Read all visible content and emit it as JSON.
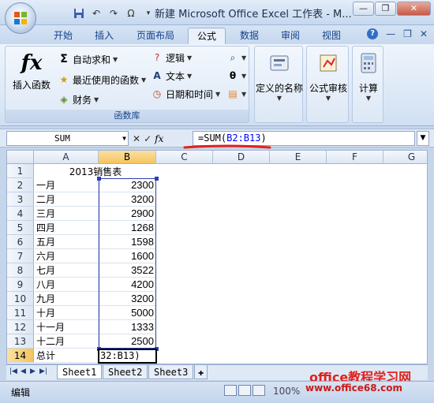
{
  "window": {
    "title": "新建 Microsoft Office Excel 工作表 - M..."
  },
  "quick_access": [
    "save-icon",
    "undo-icon",
    "redo-icon",
    "omega-icon",
    "customize-icon"
  ],
  "tabs": [
    "开始",
    "插入",
    "页面布局",
    "公式",
    "数据",
    "审阅",
    "视图"
  ],
  "active_tab": "公式",
  "ribbon": {
    "insert_function": "插入函数",
    "autosum": "自动求和",
    "recent": "最近使用的函数",
    "finance": "财务",
    "logic": "逻辑",
    "text": "文本",
    "datetime": "日期和时间",
    "library_label": "函数库",
    "defined_names": "定义的名称",
    "formula_audit": "公式审核",
    "calculation": "计算"
  },
  "formula_bar": {
    "name_box": "SUM",
    "formula_prefix": "=SUM(",
    "formula_ref": "B2:B13",
    "formula_suffix": ")",
    "fx_label": "fx"
  },
  "columns": [
    "A",
    "B",
    "C",
    "D",
    "E",
    "F",
    "G"
  ],
  "sheet": {
    "title": "2013销售表",
    "rows": [
      {
        "month": "一月",
        "value": "2300"
      },
      {
        "month": "二月",
        "value": "3200"
      },
      {
        "month": "三月",
        "value": "2900"
      },
      {
        "month": "四月",
        "value": "1268"
      },
      {
        "month": "五月",
        "value": "1598"
      },
      {
        "month": "六月",
        "value": "1600"
      },
      {
        "month": "七月",
        "value": "3522"
      },
      {
        "month": "八月",
        "value": "4200"
      },
      {
        "month": "九月",
        "value": "3200"
      },
      {
        "month": "十月",
        "value": "5000"
      },
      {
        "month": "十一月",
        "value": "1333"
      },
      {
        "month": "十二月",
        "value": "2500"
      }
    ],
    "total_label": "总计",
    "edit_text": "32:B13)"
  },
  "sheet_tabs": [
    "Sheet1",
    "Sheet2",
    "Sheet3"
  ],
  "status": {
    "mode": "编辑",
    "zoom": "100%"
  },
  "watermark": {
    "line1": "office教程学习网",
    "line2": "www.office68.com"
  }
}
